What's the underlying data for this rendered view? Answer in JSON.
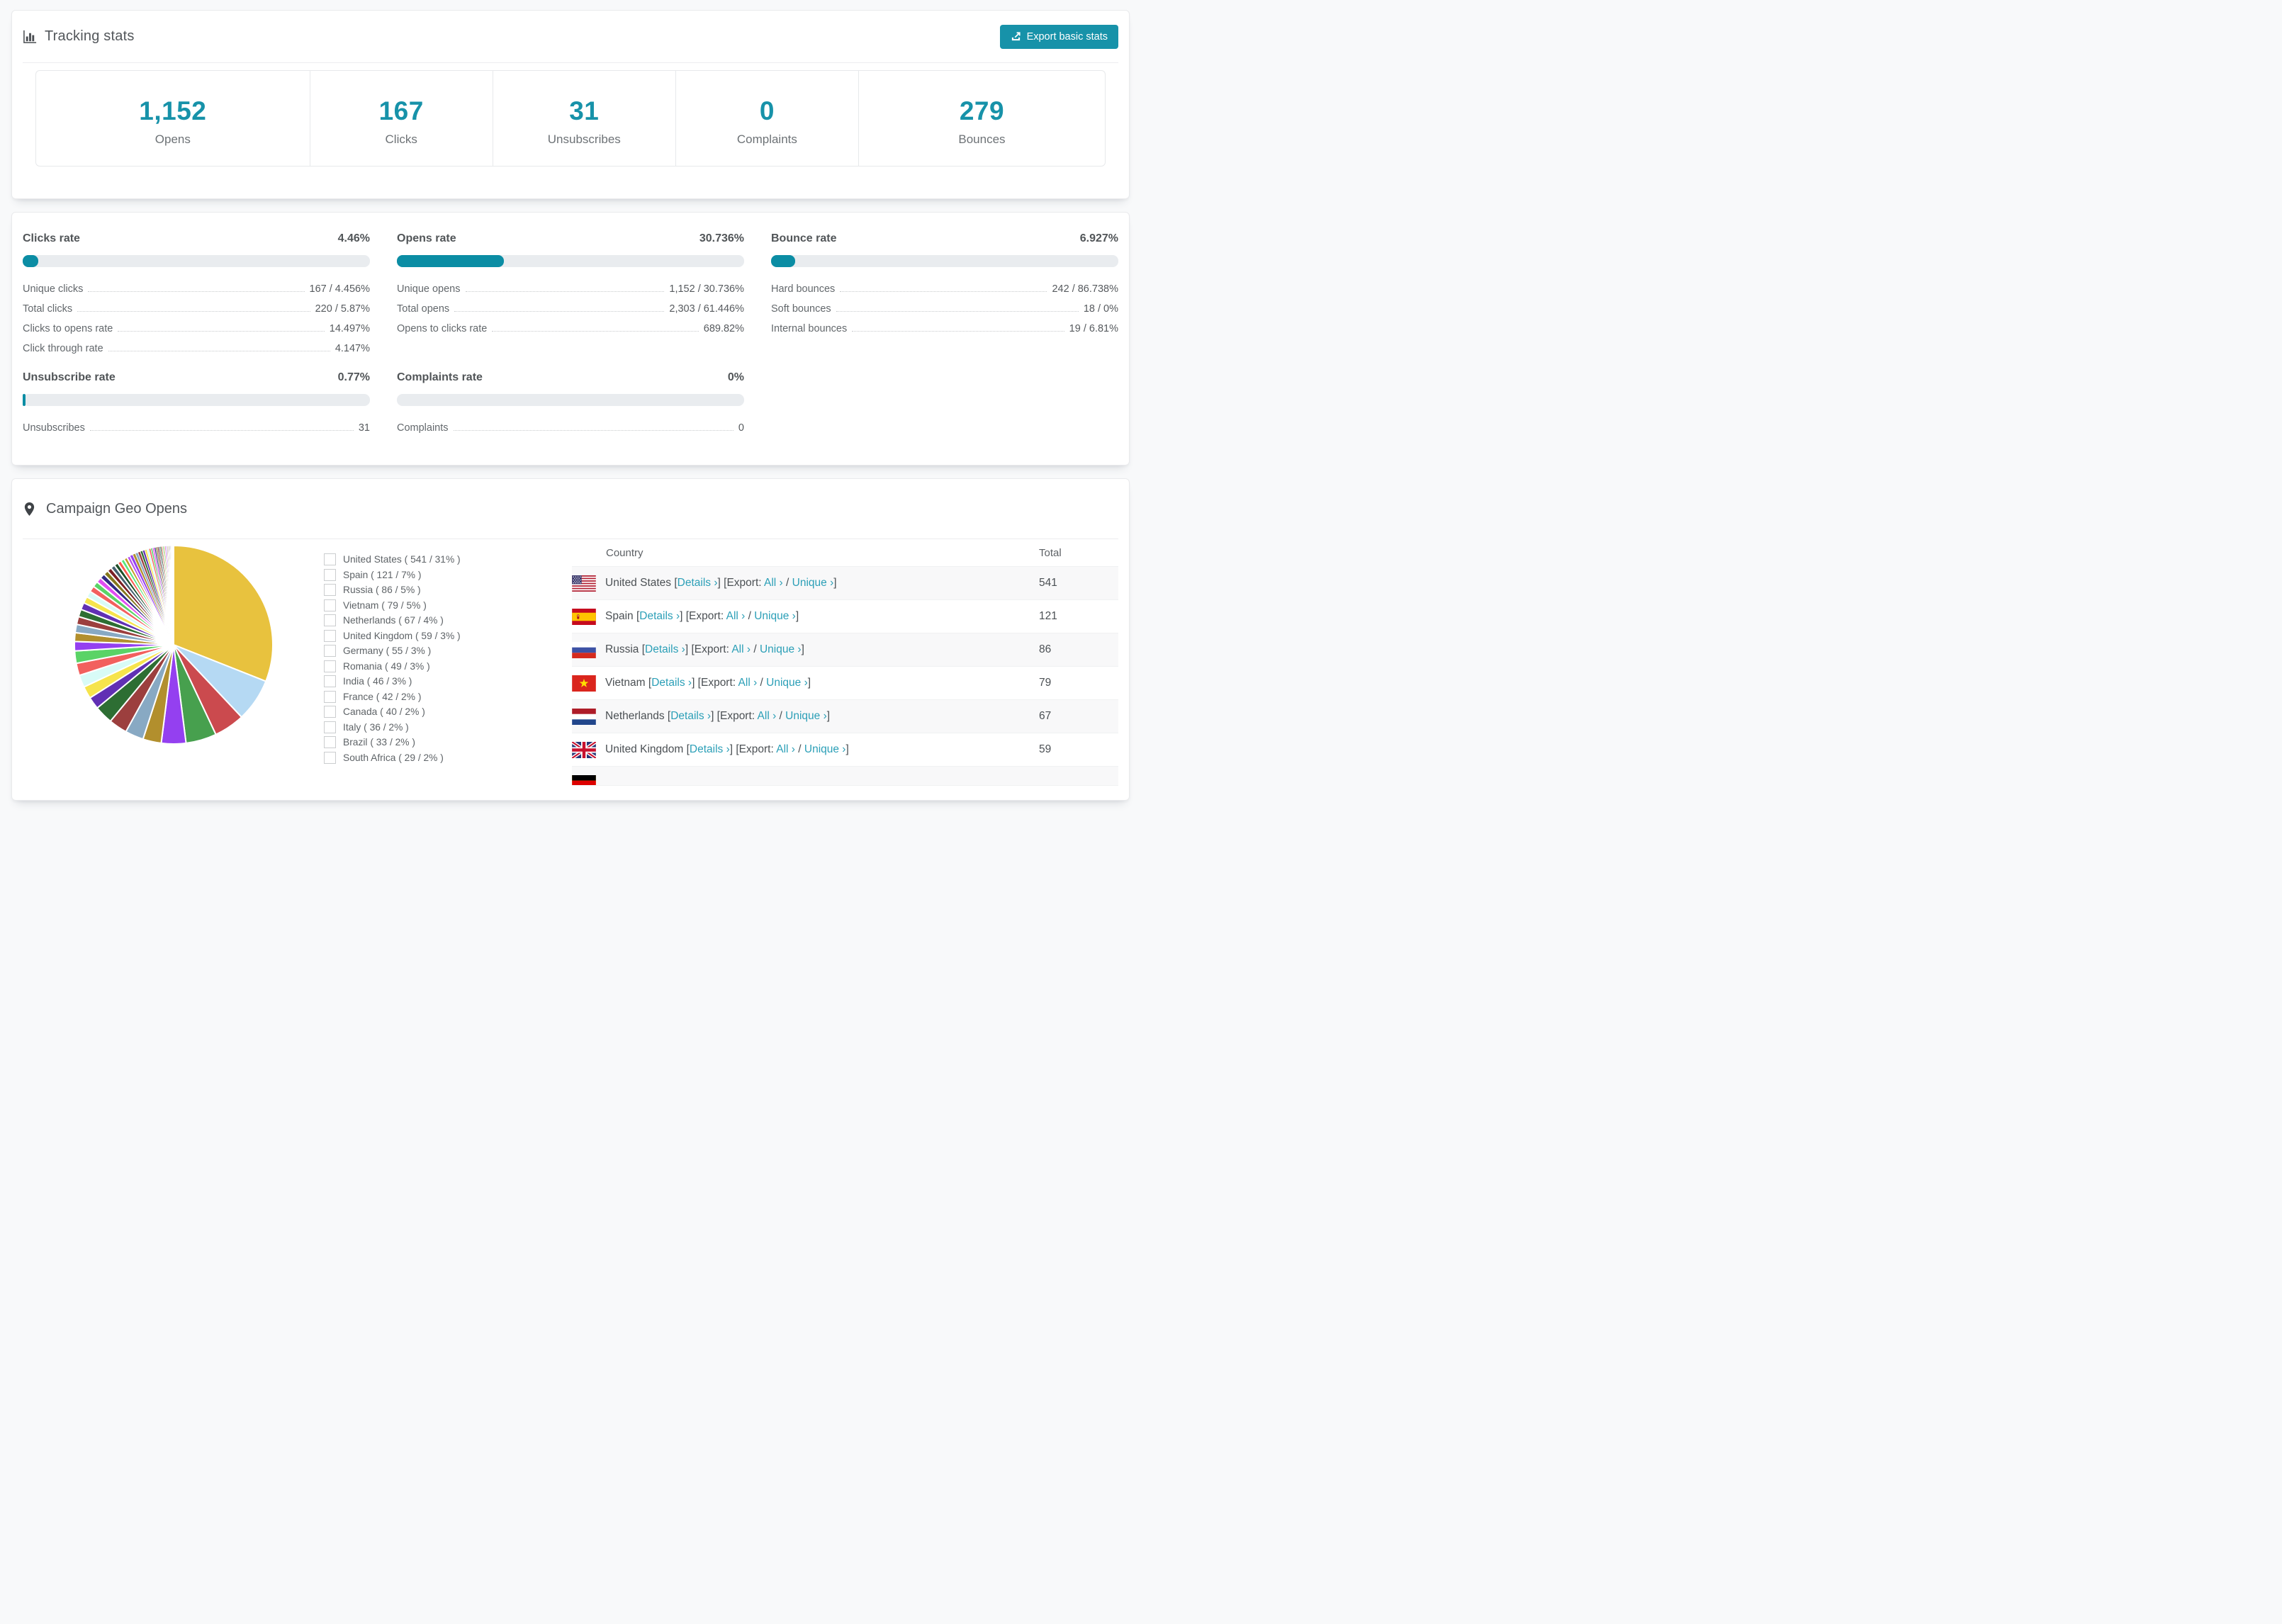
{
  "page": {
    "background": "#f8f9fa",
    "accent": "#1792a9"
  },
  "tracking_card": {
    "title": "Tracking stats",
    "title_icon": "bar-chart-icon",
    "export_button": {
      "label": "Export basic stats",
      "icon": "export-icon"
    },
    "stats": [
      {
        "value": "1,152",
        "label": "Opens"
      },
      {
        "value": "167",
        "label": "Clicks"
      },
      {
        "value": "31",
        "label": "Unsubscribes"
      },
      {
        "value": "0",
        "label": "Complaints"
      },
      {
        "value": "279",
        "label": "Bounces"
      }
    ]
  },
  "rates_card": {
    "panels": [
      {
        "title": "Clicks rate",
        "value": "4.46%",
        "percent": 4.46,
        "rows": [
          {
            "label": "Unique clicks",
            "value": "167 / 4.456%"
          },
          {
            "label": "Total clicks",
            "value": "220 / 5.87%"
          },
          {
            "label": "Clicks to opens rate",
            "value": "14.497%"
          },
          {
            "label": "Click through rate",
            "value": "4.147%"
          }
        ]
      },
      {
        "title": "Opens rate",
        "value": "30.736%",
        "percent": 30.736,
        "rows": [
          {
            "label": "Unique opens",
            "value": "1,152 / 30.736%"
          },
          {
            "label": "Total opens",
            "value": "2,303 / 61.446%"
          },
          {
            "label": "Opens to clicks rate",
            "value": "689.82%"
          }
        ]
      },
      {
        "title": "Bounce rate",
        "value": "6.927%",
        "percent": 6.927,
        "rows": [
          {
            "label": "Hard bounces",
            "value": "242 / 86.738%"
          },
          {
            "label": "Soft bounces",
            "value": "18 / 0%"
          },
          {
            "label": "Internal bounces",
            "value": "19 / 6.81%"
          }
        ]
      },
      {
        "title": "Unsubscribe rate",
        "value": "0.77%",
        "percent": 0.77,
        "rows": [
          {
            "label": "Unsubscribes",
            "value": "31"
          }
        ]
      },
      {
        "title": "Complaints rate",
        "value": "0%",
        "percent": 0,
        "rows": [
          {
            "label": "Complaints",
            "value": "0"
          }
        ]
      }
    ]
  },
  "geo_card": {
    "title": "Campaign Geo Opens",
    "title_icon": "map-pin-icon",
    "table": {
      "columns": {
        "country": "Country",
        "total": "Total"
      },
      "link_labels": {
        "bracket_open": "[",
        "bracket_close": "]",
        "details": "Details ›",
        "export_prefix": "Export:",
        "all": "All ›",
        "separator": "/",
        "unique": "Unique ›"
      },
      "rows": [
        {
          "country": "United States",
          "flag": "us",
          "total": "541"
        },
        {
          "country": "Spain",
          "flag": "es",
          "total": "121"
        },
        {
          "country": "Russia",
          "flag": "ru",
          "total": "86"
        },
        {
          "country": "Vietnam",
          "flag": "vn",
          "total": "79"
        },
        {
          "country": "Netherlands",
          "flag": "nl",
          "total": "67"
        },
        {
          "country": "United Kingdom",
          "flag": "gb",
          "total": "59"
        },
        {
          "country": "",
          "flag": "de",
          "total": "",
          "partial": true
        }
      ]
    }
  },
  "chart_data": {
    "type": "pie",
    "title": "Campaign Geo Opens",
    "legend_position": "right",
    "start_angle_deg": 0,
    "direction": "clockwise",
    "slices": [
      {
        "label": "United States",
        "value": 541,
        "percent": 31,
        "color": "#e8c23e"
      },
      {
        "label": "Spain",
        "value": 121,
        "percent": 7,
        "color": "#b5d9f3"
      },
      {
        "label": "Russia",
        "value": 86,
        "percent": 5,
        "color": "#cb4a4e"
      },
      {
        "label": "Vietnam",
        "value": 79,
        "percent": 5,
        "color": "#47a04e"
      },
      {
        "label": "Netherlands",
        "value": 67,
        "percent": 4,
        "color": "#9440f0"
      },
      {
        "label": "United Kingdom",
        "value": 59,
        "percent": 3,
        "color": "#b28f2d"
      },
      {
        "label": "Germany",
        "value": 55,
        "percent": 3,
        "color": "#88a9c3"
      },
      {
        "label": "Romania",
        "value": 49,
        "percent": 3,
        "color": "#9c3f3e"
      },
      {
        "label": "India",
        "value": 46,
        "percent": 3,
        "color": "#2d6e33"
      },
      {
        "label": "France",
        "value": 42,
        "percent": 2,
        "color": "#6130b4"
      },
      {
        "label": "Canada",
        "value": 40,
        "percent": 2,
        "color": "#f6e44c"
      },
      {
        "label": "Italy",
        "value": 36,
        "percent": 2,
        "color": "#d8fbf7"
      },
      {
        "label": "Brazil",
        "value": 33,
        "percent": 2,
        "color": "#f2605e"
      },
      {
        "label": "South Africa",
        "value": 29,
        "percent": 2,
        "color": "#5ad366"
      }
    ],
    "other_slices": {
      "note": "many additional small unlabeled country slices",
      "count": 50,
      "total_percent": 26,
      "decay": 0.945,
      "colors": [
        "#9440f0",
        "#b28f2d",
        "#88a9c3",
        "#9c3f3e",
        "#2d6e33",
        "#6130b4",
        "#f6e44c",
        "#d8fbf7",
        "#f2605e",
        "#5ad366",
        "#e04df2",
        "#312a83",
        "#85771c",
        "#7a2025",
        "#44606f",
        "#1e4f27",
        "#fb5a4e",
        "#57e77c",
        "#c59e29",
        "#b84df0"
      ]
    }
  }
}
